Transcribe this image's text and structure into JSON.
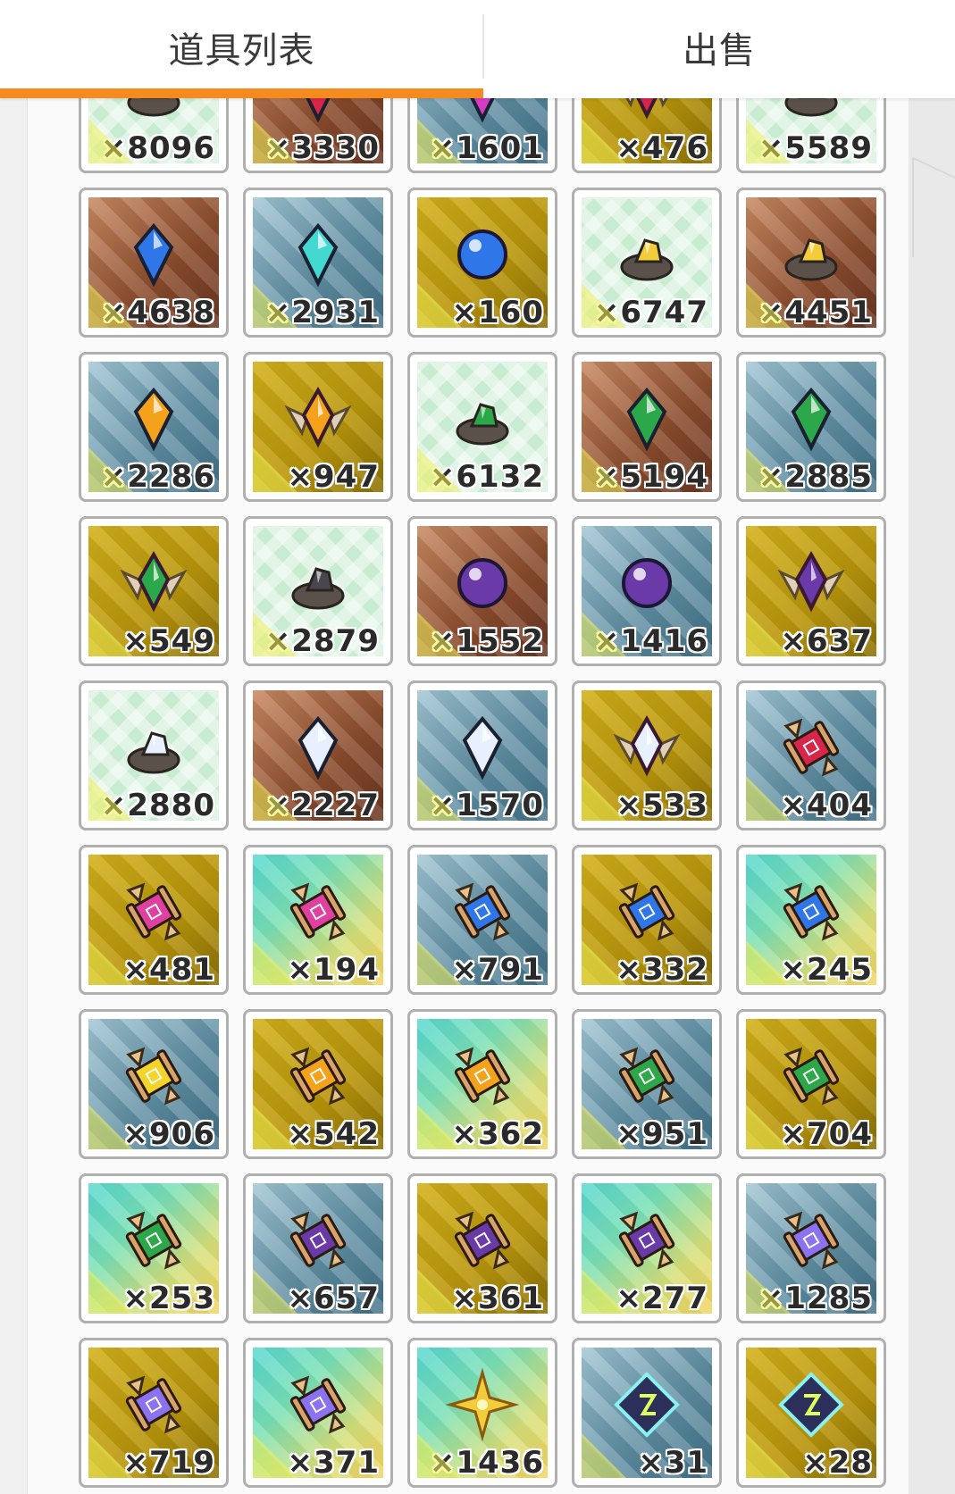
{
  "tabs": [
    {
      "label": "道具列表",
      "active": true
    },
    {
      "label": "出售",
      "active": false
    }
  ],
  "accent_color": "#f58a1e",
  "items": [
    {
      "qty": "×8096",
      "icon": "purple-gem-ore-icon",
      "bg": "green"
    },
    {
      "qty": "×3330",
      "icon": "red-gem-icon",
      "bg": "copper"
    },
    {
      "qty": "×1601",
      "icon": "magenta-gem-icon",
      "bg": "steel"
    },
    {
      "qty": "×476",
      "icon": "winged-red-gem-icon",
      "bg": "gold"
    },
    {
      "qty": "×5589",
      "icon": "dark-ore-icon",
      "bg": "green"
    },
    {
      "qty": "×4638",
      "icon": "blue-crystal-shard-icon",
      "bg": "copper"
    },
    {
      "qty": "×2931",
      "icon": "cyan-teardrop-gem-icon",
      "bg": "steel"
    },
    {
      "qty": "×160",
      "icon": "blue-orb-icon",
      "bg": "gold"
    },
    {
      "qty": "×6747",
      "icon": "gold-ore-icon",
      "bg": "green"
    },
    {
      "qty": "×4451",
      "icon": "gold-nugget-icon",
      "bg": "copper"
    },
    {
      "qty": "×2286",
      "icon": "amber-gem-icon",
      "bg": "steel"
    },
    {
      "qty": "×947",
      "icon": "winged-amber-gem-icon",
      "bg": "gold"
    },
    {
      "qty": "×6132",
      "icon": "green-ore-icon",
      "bg": "green"
    },
    {
      "qty": "×5194",
      "icon": "green-crystal-cluster-icon",
      "bg": "copper"
    },
    {
      "qty": "×2885",
      "icon": "emerald-cut-gem-icon",
      "bg": "steel"
    },
    {
      "qty": "×549",
      "icon": "emerald-on-pedestal-icon",
      "bg": "gold"
    },
    {
      "qty": "×2879",
      "icon": "dark-pebbles-icon",
      "bg": "green"
    },
    {
      "qty": "×1552",
      "icon": "purple-orb-icon",
      "bg": "copper"
    },
    {
      "qty": "×1416",
      "icon": "dark-purple-orb-icon",
      "bg": "steel"
    },
    {
      "qty": "×637",
      "icon": "winged-purple-gem-icon",
      "bg": "gold"
    },
    {
      "qty": "×2880",
      "icon": "white-ore-icon",
      "bg": "green"
    },
    {
      "qty": "×2227",
      "icon": "white-crystal-icon",
      "bg": "copper"
    },
    {
      "qty": "×1570",
      "icon": "diamond-icon",
      "bg": "steel"
    },
    {
      "qty": "×533",
      "icon": "winged-white-gem-icon",
      "bg": "gold"
    },
    {
      "qty": "×404",
      "icon": "red-scroll-icon",
      "bg": "steel"
    },
    {
      "qty": "×481",
      "icon": "pink-scroll-icon",
      "bg": "gold"
    },
    {
      "qty": "×194",
      "icon": "pink-big-scroll-icon",
      "bg": "rainbow"
    },
    {
      "qty": "×791",
      "icon": "blue-scroll-icon",
      "bg": "steel"
    },
    {
      "qty": "×332",
      "icon": "blue-scroll-icon",
      "bg": "gold"
    },
    {
      "qty": "×245",
      "icon": "blue-big-scroll-icon",
      "bg": "rainbow"
    },
    {
      "qty": "×906",
      "icon": "yellow-scroll-icon",
      "bg": "steel"
    },
    {
      "qty": "×542",
      "icon": "orange-scroll-icon",
      "bg": "gold"
    },
    {
      "qty": "×362",
      "icon": "orange-big-scroll-icon",
      "bg": "rainbow"
    },
    {
      "qty": "×951",
      "icon": "green-scroll-icon",
      "bg": "steel"
    },
    {
      "qty": "×704",
      "icon": "green-scroll-icon",
      "bg": "gold"
    },
    {
      "qty": "×253",
      "icon": "green-big-scroll-icon",
      "bg": "rainbow"
    },
    {
      "qty": "×657",
      "icon": "purple-scroll-icon",
      "bg": "steel"
    },
    {
      "qty": "×361",
      "icon": "purple-scroll-icon",
      "bg": "gold"
    },
    {
      "qty": "×277",
      "icon": "purple-big-scroll-icon",
      "bg": "rainbow"
    },
    {
      "qty": "×1285",
      "icon": "violet-scroll-icon",
      "bg": "steel"
    },
    {
      "qty": "×719",
      "icon": "violet-scroll-icon",
      "bg": "gold"
    },
    {
      "qty": "×371",
      "icon": "violet-big-scroll-icon",
      "bg": "rainbow"
    },
    {
      "qty": "×1436",
      "icon": "golden-star-icon",
      "bg": "rainbow"
    },
    {
      "qty": "×31",
      "icon": "rune-tile-icon",
      "bg": "steel"
    },
    {
      "qty": "×28",
      "icon": "rune-card-icon",
      "bg": "gold"
    }
  ]
}
